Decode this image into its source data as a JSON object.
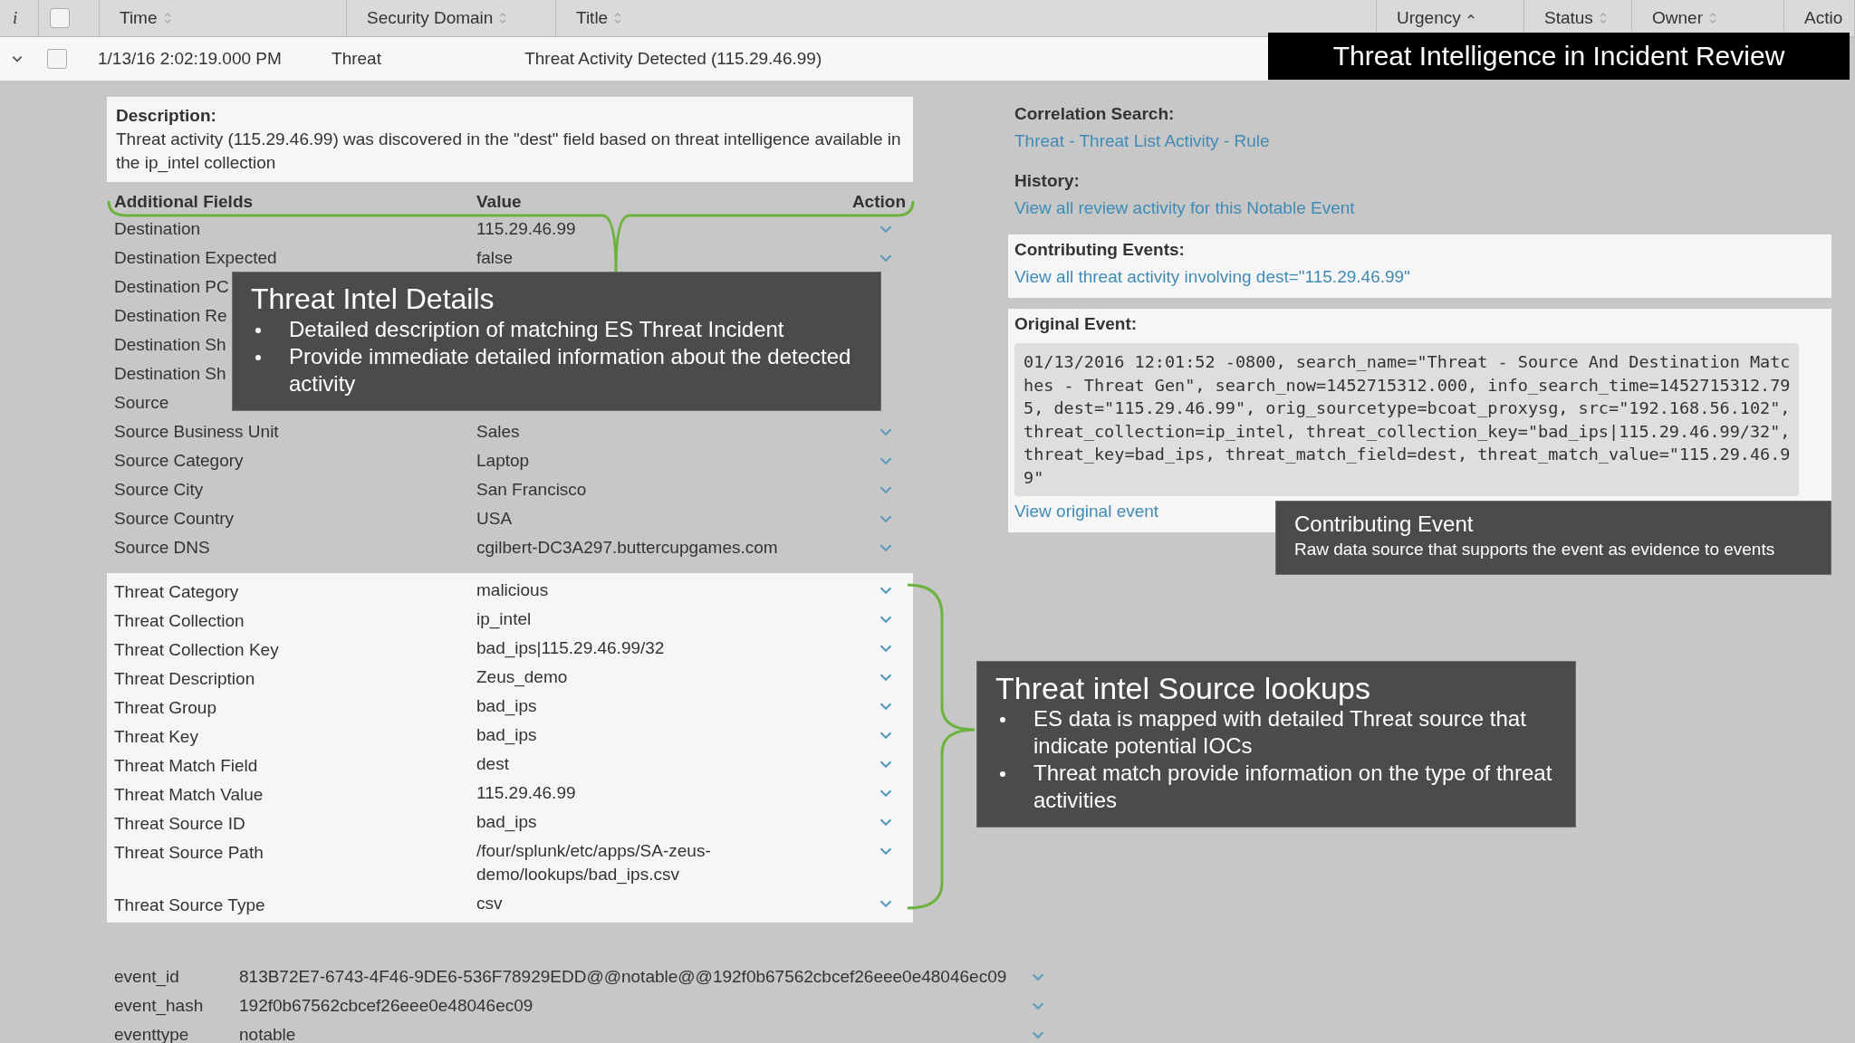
{
  "banner": {
    "title": "Threat Intelligence in Incident Review"
  },
  "table": {
    "columns": [
      {
        "label": "i",
        "kind": "info"
      },
      {
        "kind": "checkbox",
        "checked": false
      },
      {
        "label": "Time",
        "kind": "text",
        "sortable": true,
        "sort_ascending": false
      },
      {
        "label": "Security Domain",
        "kind": "text",
        "sortable": true,
        "sort_ascending": false
      },
      {
        "label": "Title",
        "kind": "text",
        "sortable": true,
        "sort_ascending": false
      },
      {
        "label": "Urgency",
        "kind": "text",
        "sortable": true,
        "sort_ascending": true
      },
      {
        "label": "Status",
        "kind": "text",
        "sortable": true,
        "sort_ascending": false
      },
      {
        "label": "Owner",
        "kind": "text",
        "sortable": true,
        "sort_ascending": false
      },
      {
        "label": "Actio",
        "kind": "text",
        "sortable": false
      }
    ],
    "rows": [
      {
        "expanded": true,
        "checked": false,
        "time": "1/13/16 2:02:19.000 PM",
        "security_domain": "Threat",
        "title": "Threat Activity Detected (115.29.46.99)"
      }
    ]
  },
  "description": {
    "label": "Description:",
    "text": "Threat activity (115.29.46.99) was discovered in the \"dest\" field based on threat intelligence available in the ip_intel collection"
  },
  "fields": {
    "headers": [
      "Additional Fields",
      "Value",
      "Action"
    ],
    "rows": [
      {
        "name": "Destination",
        "value": "115.29.46.99",
        "action": true
      },
      {
        "name": "Destination Expected",
        "value": "false",
        "action": true
      },
      {
        "name": "Destination PC",
        "action": false
      },
      {
        "name": "Destination Re",
        "action": false
      },
      {
        "name": "Destination Sh",
        "action": false
      },
      {
        "name": "Destination Sh",
        "action": false
      },
      {
        "name": "Source",
        "action": false
      },
      {
        "name": "Source Business Unit",
        "value": "Sales",
        "action": true
      },
      {
        "name": "Source Category",
        "value": "Laptop",
        "action": true
      },
      {
        "name": "Source City",
        "value": "San Francisco",
        "action": true
      },
      {
        "name": "Source Country",
        "value": "USA",
        "action": true
      },
      {
        "name": "Source DNS",
        "value": "cgilbert-DC3A297.buttercupgames.com",
        "action": true
      }
    ],
    "threat_rows": [
      {
        "name": "Threat Category",
        "value": "malicious",
        "action": true
      },
      {
        "name": "Threat Collection",
        "value": "ip_intel",
        "action": true
      },
      {
        "name": "Threat Collection Key",
        "value": "bad_ips|115.29.46.99/32",
        "action": true
      },
      {
        "name": "Threat Description",
        "value": "Zeus_demo",
        "action": true
      },
      {
        "name": "Threat Group",
        "value": "bad_ips",
        "action": true
      },
      {
        "name": "Threat Key",
        "value": "bad_ips",
        "action": true
      },
      {
        "name": "Threat Match Field",
        "value": "dest",
        "action": true
      },
      {
        "name": "Threat Match Value",
        "value": "115.29.46.99",
        "action": true
      },
      {
        "name": "Threat Source ID",
        "value": "bad_ips",
        "action": true
      },
      {
        "name": "Threat Source Path",
        "value": "/four/splunk/etc/apps/SA-zeus-demo/lookups/bad_ips.csv",
        "action": true
      },
      {
        "name": "Threat Source Type",
        "value": "csv",
        "action": true
      }
    ]
  },
  "event_fields": [
    {
      "name": "event_id",
      "value": "813B72E7-6743-4F46-9DE6-536F78929EDD@@notable@@192f0b67562cbcef26eee0e48046ec09"
    },
    {
      "name": "event_hash",
      "value": "192f0b67562cbcef26eee0e48046ec09"
    },
    {
      "name": "eventtype",
      "value": "notable"
    }
  ],
  "correlation": {
    "label": "Correlation Search:",
    "link": "Threat - Threat List Activity - Rule"
  },
  "history": {
    "label": "History:",
    "link": "View all review activity for this Notable Event"
  },
  "contributing": {
    "label": "Contributing Events:",
    "link": "View all threat activity involving dest=\"115.29.46.99\""
  },
  "original_event": {
    "label": "Original Event:",
    "raw": "01/13/2016 12:01:52 -0800, search_name=\"Threat - Source And Destination Matches - Threat Gen\", search_now=1452715312.000, info_search_time=1452715312.795, dest=\"115.29.46.99\", orig_sourcetype=bcoat_proxysg, src=\"192.168.56.102\", threat_collection=ip_intel, threat_collection_key=\"bad_ips|115.29.46.99/32\", threat_key=bad_ips, threat_match_field=dest, threat_match_value=\"115.29.46.99\"",
    "link": "View original event"
  },
  "annotations": [
    {
      "title": "Threat Intel Details",
      "bullets": [
        "Detailed description of matching ES Threat Incident",
        "Provide immediate detailed information about the detected activity"
      ]
    },
    {
      "title": "Contributing Event",
      "text": "Raw data source that supports the event as evidence to events"
    },
    {
      "title": "Threat intel Source lookups",
      "bullets": [
        "ES data is mapped with detailed Threat source that indicate potential IOCs",
        "Threat match provide information on the type of threat activities"
      ]
    }
  ]
}
